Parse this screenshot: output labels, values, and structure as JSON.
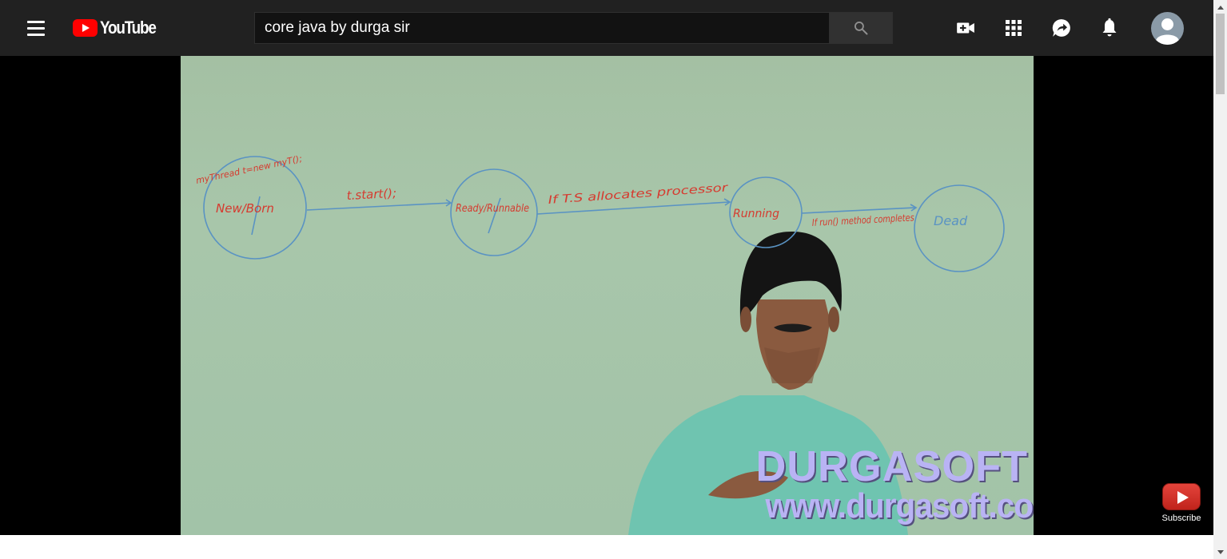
{
  "header": {
    "menu_icon": "hamburger-menu-icon",
    "logo_text": "YouTube",
    "search": {
      "value": "core java by durga sir",
      "icon": "search-icon"
    },
    "actions": [
      {
        "name": "create-video-icon"
      },
      {
        "name": "apps-grid-icon"
      },
      {
        "name": "messages-icon"
      },
      {
        "name": "notifications-bell-icon"
      }
    ],
    "avatar_icon": "account-avatar-icon"
  },
  "video": {
    "whiteboard": {
      "states": [
        "New/Born",
        "Ready/Runnable",
        "Running",
        "Dead"
      ],
      "annotations": {
        "creation": "myThread t=new myT();",
        "start": "t.start();",
        "allocate": "If T.S allocates processor",
        "complete": "If run() method completes"
      }
    },
    "watermark": {
      "brand": "DURGASOFT",
      "url": "www.durgasoft.com"
    },
    "subscribe_label": "Subscribe"
  },
  "colors": {
    "topbar": "#212121",
    "brand_red": "#ff0000",
    "watermark": "#b9b3f4",
    "marker_red": "#d63a2f",
    "marker_blue": "#5a93c3"
  }
}
